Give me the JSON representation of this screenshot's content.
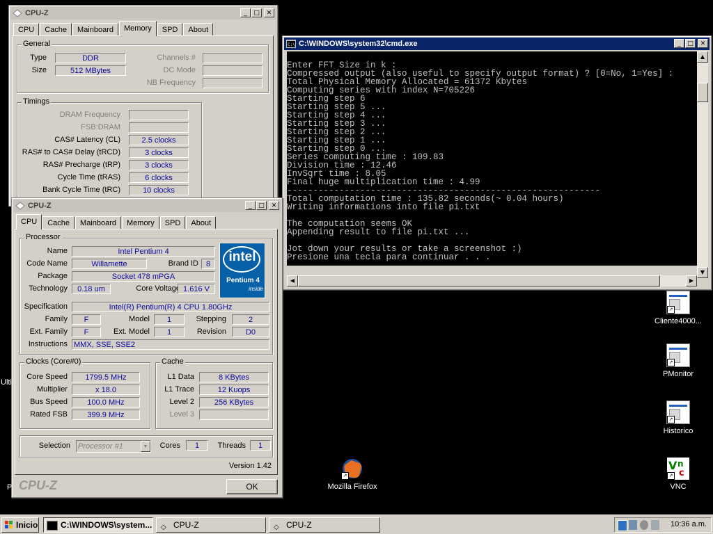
{
  "cpuz_memory": {
    "title": "CPU-Z",
    "tabs": [
      "CPU",
      "Cache",
      "Mainboard",
      "Memory",
      "SPD",
      "About"
    ],
    "general": {
      "legend": "General",
      "type_label": "Type",
      "type_value": "DDR",
      "size_label": "Size",
      "size_value": "512 MBytes",
      "channels_label": "Channels #",
      "dcmode_label": "DC Mode",
      "nbfreq_label": "NB Frequency"
    },
    "timings": {
      "legend": "Timings",
      "rows": [
        {
          "label": "DRAM Frequency",
          "value": "",
          "disabled": true
        },
        {
          "label": "FSB:DRAM",
          "value": "",
          "disabled": true
        },
        {
          "label": "CAS# Latency (CL)",
          "value": "2.5 clocks"
        },
        {
          "label": "RAS# to CAS# Delay (tRCD)",
          "value": "3 clocks"
        },
        {
          "label": "RAS# Precharge (tRP)",
          "value": "3 clocks"
        },
        {
          "label": "Cycle Time (tRAS)",
          "value": "6 clocks"
        },
        {
          "label": "Bank Cycle Time (tRC)",
          "value": "10 clocks"
        }
      ]
    }
  },
  "cpuz_cpu": {
    "title": "CPU-Z",
    "tabs": [
      "CPU",
      "Cache",
      "Mainboard",
      "Memory",
      "SPD",
      "About"
    ],
    "processor": {
      "legend": "Processor",
      "name_label": "Name",
      "name_value": "Intel Pentium 4",
      "codename_label": "Code Name",
      "codename_value": "Willamette",
      "brandid_label": "Brand ID",
      "brandid_value": "8",
      "package_label": "Package",
      "package_value": "Socket 478 mPGA",
      "technology_label": "Technology",
      "technology_value": "0.18 um",
      "voltage_label": "Core Voltage",
      "voltage_value": "1.616 V",
      "spec_label": "Specification",
      "spec_value": "Intel(R) Pentium(R) 4 CPU 1.80GHz",
      "family_label": "Family",
      "family_value": "F",
      "model_label": "Model",
      "model_value": "1",
      "stepping_label": "Stepping",
      "stepping_value": "2",
      "extfamily_label": "Ext. Family",
      "extfamily_value": "F",
      "extmodel_label": "Ext. Model",
      "extmodel_value": "1",
      "revision_label": "Revision",
      "revision_value": "D0",
      "instructions_label": "Instructions",
      "instructions_value": "MMX, SSE, SSE2",
      "logo_brand": "intel",
      "logo_line1": "Pentium 4",
      "logo_line2": "inside"
    },
    "clocks": {
      "legend": "Clocks (Core#0)",
      "core_speed_label": "Core Speed",
      "core_speed_value": "1799.5 MHz",
      "multiplier_label": "Multiplier",
      "multiplier_value": "x 18.0",
      "bus_speed_label": "Bus Speed",
      "bus_speed_value": "100.0 MHz",
      "rated_fsb_label": "Rated FSB",
      "rated_fsb_value": "399.9 MHz"
    },
    "cache": {
      "legend": "Cache",
      "l1data_label": "L1 Data",
      "l1data_value": "8 KBytes",
      "l1trace_label": "L1 Trace",
      "l1trace_value": "12 Kuops",
      "level2_label": "Level 2",
      "level2_value": "256 KBytes",
      "level3_label": "Level 3",
      "level3_value": ""
    },
    "selection_label": "Selection",
    "selection_value": "Processor #1",
    "cores_label": "Cores",
    "cores_value": "1",
    "threads_label": "Threads",
    "threads_value": "1",
    "version": "Version 1.42",
    "brand": "CPU-Z",
    "ok_label": "OK"
  },
  "cmd": {
    "title": "C:\\WINDOWS\\system32\\cmd.exe",
    "lines": [
      "",
      "Enter FFT Size in k :",
      "Compressed output (also useful to specify output format) ? [0=No, 1=Yes] :",
      "Total Physical Memory Allocated = 61372 Kbytes",
      "Computing series with index N=705226",
      "Starting step 6",
      "Starting step 5 ...",
      "Starting step 4 ...",
      "Starting step 3 ...",
      "Starting step 2 ...",
      "Starting step 1 ...",
      "Starting step 0 ...",
      "Series computing time : 109.83",
      "Division time : 12.46",
      "InvSqrt time : 8.05",
      "Final huge multiplication time : 4.99",
      "------------------------------------------------------------",
      "Total computation time : 135.82 seconds(~ 0.04 hours)",
      "Writing informations into file pi.txt",
      "",
      "The computation seems OK",
      "Appending result to file pi.txt ...",
      "",
      "Jot down your results or take a screenshot :)",
      "Presione una tecla para continuar . . ."
    ]
  },
  "desktop": {
    "icons": [
      {
        "label": "Cliente4000..."
      },
      {
        "label": "PMonitor"
      },
      {
        "label": "Historico"
      },
      {
        "label": "VNC"
      },
      {
        "label": "Mozilla Firefox"
      }
    ],
    "partial_left_1": "Ulti",
    "partial_left_2": "P"
  },
  "taskbar": {
    "start_label": "Inicio",
    "items": [
      {
        "label": "C:\\WINDOWS\\system..."
      },
      {
        "label": "CPU-Z"
      },
      {
        "label": "CPU-Z"
      }
    ],
    "clock": "10:36 a.m."
  }
}
